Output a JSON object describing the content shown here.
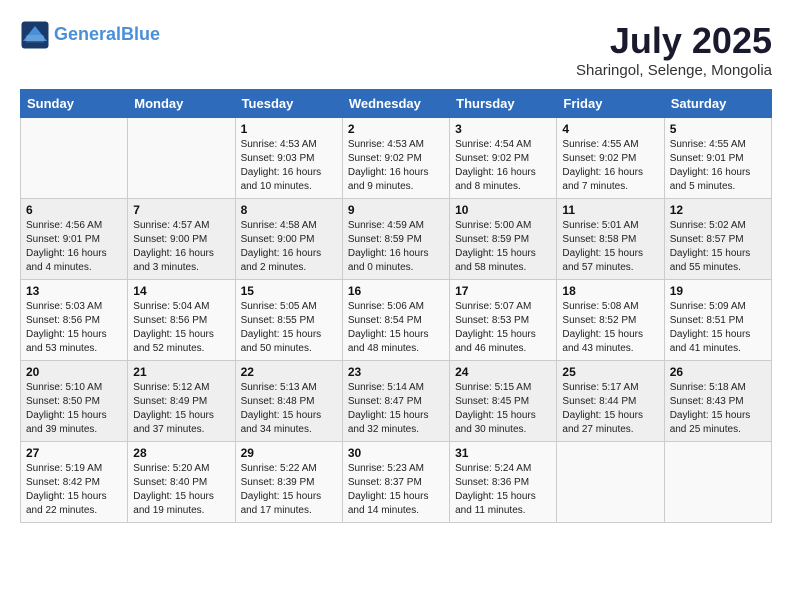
{
  "header": {
    "logo_line1": "General",
    "logo_line2": "Blue",
    "month_title": "July 2025",
    "location": "Sharingol, Selenge, Mongolia"
  },
  "weekdays": [
    "Sunday",
    "Monday",
    "Tuesday",
    "Wednesday",
    "Thursday",
    "Friday",
    "Saturday"
  ],
  "weeks": [
    [
      {
        "day": "",
        "info": ""
      },
      {
        "day": "",
        "info": ""
      },
      {
        "day": "1",
        "info": "Sunrise: 4:53 AM\nSunset: 9:03 PM\nDaylight: 16 hours\nand 10 minutes."
      },
      {
        "day": "2",
        "info": "Sunrise: 4:53 AM\nSunset: 9:02 PM\nDaylight: 16 hours\nand 9 minutes."
      },
      {
        "day": "3",
        "info": "Sunrise: 4:54 AM\nSunset: 9:02 PM\nDaylight: 16 hours\nand 8 minutes."
      },
      {
        "day": "4",
        "info": "Sunrise: 4:55 AM\nSunset: 9:02 PM\nDaylight: 16 hours\nand 7 minutes."
      },
      {
        "day": "5",
        "info": "Sunrise: 4:55 AM\nSunset: 9:01 PM\nDaylight: 16 hours\nand 5 minutes."
      }
    ],
    [
      {
        "day": "6",
        "info": "Sunrise: 4:56 AM\nSunset: 9:01 PM\nDaylight: 16 hours\nand 4 minutes."
      },
      {
        "day": "7",
        "info": "Sunrise: 4:57 AM\nSunset: 9:00 PM\nDaylight: 16 hours\nand 3 minutes."
      },
      {
        "day": "8",
        "info": "Sunrise: 4:58 AM\nSunset: 9:00 PM\nDaylight: 16 hours\nand 2 minutes."
      },
      {
        "day": "9",
        "info": "Sunrise: 4:59 AM\nSunset: 8:59 PM\nDaylight: 16 hours\nand 0 minutes."
      },
      {
        "day": "10",
        "info": "Sunrise: 5:00 AM\nSunset: 8:59 PM\nDaylight: 15 hours\nand 58 minutes."
      },
      {
        "day": "11",
        "info": "Sunrise: 5:01 AM\nSunset: 8:58 PM\nDaylight: 15 hours\nand 57 minutes."
      },
      {
        "day": "12",
        "info": "Sunrise: 5:02 AM\nSunset: 8:57 PM\nDaylight: 15 hours\nand 55 minutes."
      }
    ],
    [
      {
        "day": "13",
        "info": "Sunrise: 5:03 AM\nSunset: 8:56 PM\nDaylight: 15 hours\nand 53 minutes."
      },
      {
        "day": "14",
        "info": "Sunrise: 5:04 AM\nSunset: 8:56 PM\nDaylight: 15 hours\nand 52 minutes."
      },
      {
        "day": "15",
        "info": "Sunrise: 5:05 AM\nSunset: 8:55 PM\nDaylight: 15 hours\nand 50 minutes."
      },
      {
        "day": "16",
        "info": "Sunrise: 5:06 AM\nSunset: 8:54 PM\nDaylight: 15 hours\nand 48 minutes."
      },
      {
        "day": "17",
        "info": "Sunrise: 5:07 AM\nSunset: 8:53 PM\nDaylight: 15 hours\nand 46 minutes."
      },
      {
        "day": "18",
        "info": "Sunrise: 5:08 AM\nSunset: 8:52 PM\nDaylight: 15 hours\nand 43 minutes."
      },
      {
        "day": "19",
        "info": "Sunrise: 5:09 AM\nSunset: 8:51 PM\nDaylight: 15 hours\nand 41 minutes."
      }
    ],
    [
      {
        "day": "20",
        "info": "Sunrise: 5:10 AM\nSunset: 8:50 PM\nDaylight: 15 hours\nand 39 minutes."
      },
      {
        "day": "21",
        "info": "Sunrise: 5:12 AM\nSunset: 8:49 PM\nDaylight: 15 hours\nand 37 minutes."
      },
      {
        "day": "22",
        "info": "Sunrise: 5:13 AM\nSunset: 8:48 PM\nDaylight: 15 hours\nand 34 minutes."
      },
      {
        "day": "23",
        "info": "Sunrise: 5:14 AM\nSunset: 8:47 PM\nDaylight: 15 hours\nand 32 minutes."
      },
      {
        "day": "24",
        "info": "Sunrise: 5:15 AM\nSunset: 8:45 PM\nDaylight: 15 hours\nand 30 minutes."
      },
      {
        "day": "25",
        "info": "Sunrise: 5:17 AM\nSunset: 8:44 PM\nDaylight: 15 hours\nand 27 minutes."
      },
      {
        "day": "26",
        "info": "Sunrise: 5:18 AM\nSunset: 8:43 PM\nDaylight: 15 hours\nand 25 minutes."
      }
    ],
    [
      {
        "day": "27",
        "info": "Sunrise: 5:19 AM\nSunset: 8:42 PM\nDaylight: 15 hours\nand 22 minutes."
      },
      {
        "day": "28",
        "info": "Sunrise: 5:20 AM\nSunset: 8:40 PM\nDaylight: 15 hours\nand 19 minutes."
      },
      {
        "day": "29",
        "info": "Sunrise: 5:22 AM\nSunset: 8:39 PM\nDaylight: 15 hours\nand 17 minutes."
      },
      {
        "day": "30",
        "info": "Sunrise: 5:23 AM\nSunset: 8:37 PM\nDaylight: 15 hours\nand 14 minutes."
      },
      {
        "day": "31",
        "info": "Sunrise: 5:24 AM\nSunset: 8:36 PM\nDaylight: 15 hours\nand 11 minutes."
      },
      {
        "day": "",
        "info": ""
      },
      {
        "day": "",
        "info": ""
      }
    ]
  ]
}
